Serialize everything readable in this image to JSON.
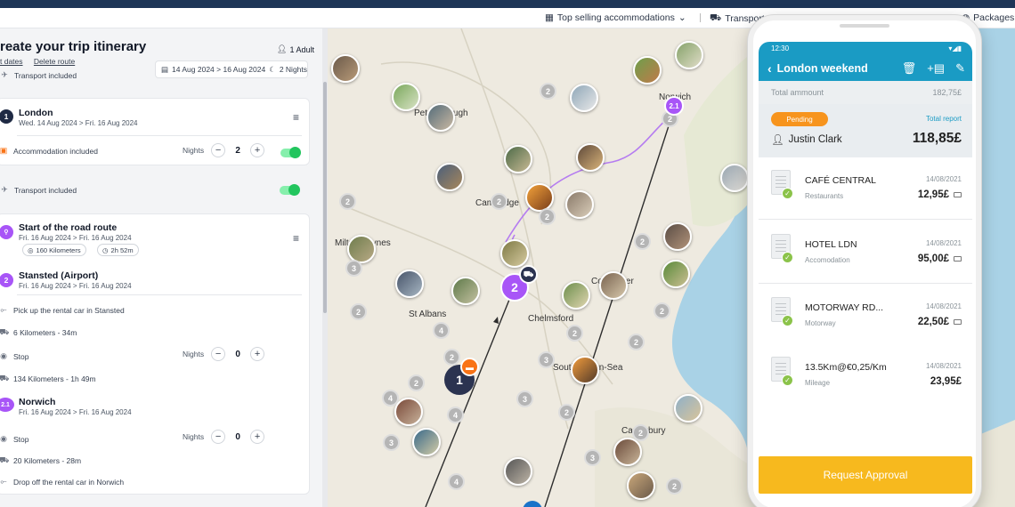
{
  "topnav": {
    "top_selling": "Top selling accommodations",
    "transport": "Transport",
    "packages": "Packages"
  },
  "itinerary": {
    "title": "reate your trip itinerary",
    "link_dates": "t dates",
    "link_delete": "Delete route",
    "adults": "1 Adult",
    "date_range": "14 Aug 2024 > 16 Aug 2024",
    "nights": "2 Nights",
    "transport_top": "Transport included",
    "london": {
      "num": "1",
      "name": "London",
      "dates": "Wed. 14 Aug 2024 > Fri. 16 Aug 2024",
      "accommodation": "Accommodation included",
      "nights_label": "Nights",
      "nights_value": "2"
    },
    "transport_mid": "Transport included",
    "road": {
      "name": "Start of the road route",
      "dates": "Fri. 16 Aug 2024 > Fri. 16 Aug 2024",
      "km": "160 Kilometers",
      "time": "2h 52m"
    },
    "stansted": {
      "num": "2",
      "name": "Stansted (Airport)",
      "dates": "Fri. 16 Aug 2024 > Fri. 16 Aug 2024",
      "pickup": "Pick up the rental car in Stansted",
      "leg1": "6 Kilometers - 34m",
      "stop": "Stop",
      "nights_label": "Nights",
      "nights_value": "0",
      "leg2": "134 Kilometers - 1h 49m"
    },
    "norwich": {
      "num": "2.1",
      "name": "Norwich",
      "dates": "Fri. 16 Aug 2024 > Fri. 16 Aug 2024",
      "stop": "Stop",
      "nights_label": "Nights",
      "nights_value": "0",
      "leg": "20 Kilometers - 28m",
      "dropoff": "Drop off the rental car in Norwich"
    }
  },
  "map": {
    "places": [
      "Norwich",
      "Peterborough",
      "Cambridge",
      "Milton Keynes",
      "St Albans",
      "Chelmsford",
      "Colchester",
      "Southend-on-Sea",
      "Canterbury"
    ],
    "clusters": [
      "2",
      "2",
      "2",
      "2",
      "2",
      "2",
      "2",
      "2",
      "2",
      "4",
      "3",
      "2",
      "4",
      "4",
      "3",
      "3",
      "2",
      "2",
      "3",
      "2",
      "4",
      "2",
      "3",
      "2"
    ],
    "marker_london": "1",
    "marker_stansted": "2",
    "marker_norwich": "2.1"
  },
  "phone": {
    "time": "12:30",
    "title": "London weekend",
    "total_label": "Total ammount",
    "total_value": "182,75£",
    "status": "Pending",
    "total_report": "Total report",
    "person": "Justin Clark",
    "person_amount": "118,85£",
    "expenses": [
      {
        "name": "CAFÉ CENTRAL",
        "category": "Restaurants",
        "date": "14/08/2021",
        "amount": "12,95£"
      },
      {
        "name": "HOTEL LDN",
        "category": "Accomodation",
        "date": "14/08/2021",
        "amount": "95,00£"
      },
      {
        "name": "MOTORWAY RD...",
        "category": "Motorway",
        "date": "14/08/2021",
        "amount": "22,50£"
      },
      {
        "name": "13.5Km@€0,25/Km",
        "category": "Mileage",
        "date": "14/08/2021",
        "amount": "23,95£"
      }
    ],
    "approve": "Request Approval"
  },
  "colors": {
    "navy": "#1d3557",
    "purple": "#a855f7",
    "app_blue": "#1a9bc4",
    "pending_orange": "#f7941d",
    "approve_yellow": "#f7b91e",
    "toggle_green": "#22c55e"
  }
}
